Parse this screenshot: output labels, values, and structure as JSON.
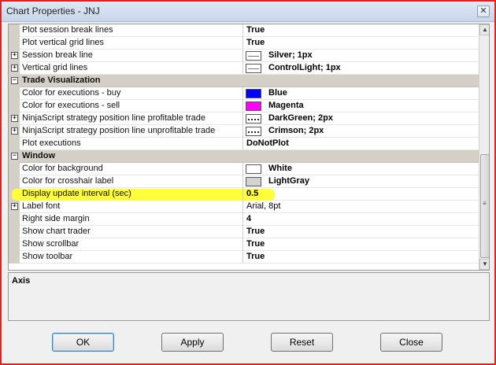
{
  "window": {
    "title": "Chart Properties - JNJ",
    "close_glyph": "✕"
  },
  "rows": [
    {
      "type": "item",
      "label": "Plot session break lines",
      "value": "True"
    },
    {
      "type": "item",
      "label": "Plot vertical grid lines",
      "value": "True"
    },
    {
      "type": "item",
      "expand": true,
      "label": "Session break line",
      "value": "Silver; 1px",
      "swatch": "line",
      "swatch_color": "#ffffff"
    },
    {
      "type": "item",
      "expand": true,
      "label": "Vertical grid lines",
      "value": "ControlLight; 1px",
      "swatch": "line",
      "swatch_color": "#ffffff"
    },
    {
      "type": "category",
      "label": "Trade Visualization"
    },
    {
      "type": "item",
      "label": "Color for executions - buy",
      "value": "Blue",
      "swatch": "fill",
      "swatch_color": "#0000ff"
    },
    {
      "type": "item",
      "label": "Color for executions - sell",
      "value": "Magenta",
      "swatch": "fill",
      "swatch_color": "#ff00ff"
    },
    {
      "type": "item",
      "expand": true,
      "label": "NinjaScript strategy position line profitable trade",
      "value": "DarkGreen; 2px",
      "swatch": "dotted",
      "swatch_color": "#ffffff"
    },
    {
      "type": "item",
      "expand": true,
      "label": "NinjaScript strategy position line unprofitable trade",
      "value": "Crimson; 2px",
      "swatch": "dotted",
      "swatch_color": "#ffffff"
    },
    {
      "type": "item",
      "label": "Plot executions",
      "value": "DoNotPlot"
    },
    {
      "type": "category",
      "label": "Window"
    },
    {
      "type": "item",
      "label": "Color for background",
      "value": "White",
      "swatch": "fill",
      "swatch_color": "#ffffff"
    },
    {
      "type": "item",
      "label": "Color for crosshair label",
      "value": "LightGray",
      "swatch": "fill",
      "swatch_color": "#d3d3d3"
    },
    {
      "type": "item",
      "label": "Display update interval (sec)",
      "value": "0.5",
      "highlight": true
    },
    {
      "type": "item",
      "expand": true,
      "label": "Label font",
      "value": "Arial, 8pt",
      "plain": true
    },
    {
      "type": "item",
      "label": "Right side margin",
      "value": "4"
    },
    {
      "type": "item",
      "label": "Show chart trader",
      "value": "True"
    },
    {
      "type": "item",
      "label": "Show scrollbar",
      "value": "True"
    },
    {
      "type": "item",
      "label": "Show toolbar",
      "value": "True"
    }
  ],
  "scrollbar": {
    "up_glyph": "▲",
    "down_glyph": "▼",
    "grip_glyph": "≡"
  },
  "description": {
    "title": "Axis"
  },
  "buttons": {
    "ok": "OK",
    "apply": "Apply",
    "reset": "Reset",
    "close": "Close"
  },
  "colors": {
    "highlight": "#ffff3a",
    "category_bg": "#d4d0c8",
    "default_button_border": "#3c7fb1"
  }
}
